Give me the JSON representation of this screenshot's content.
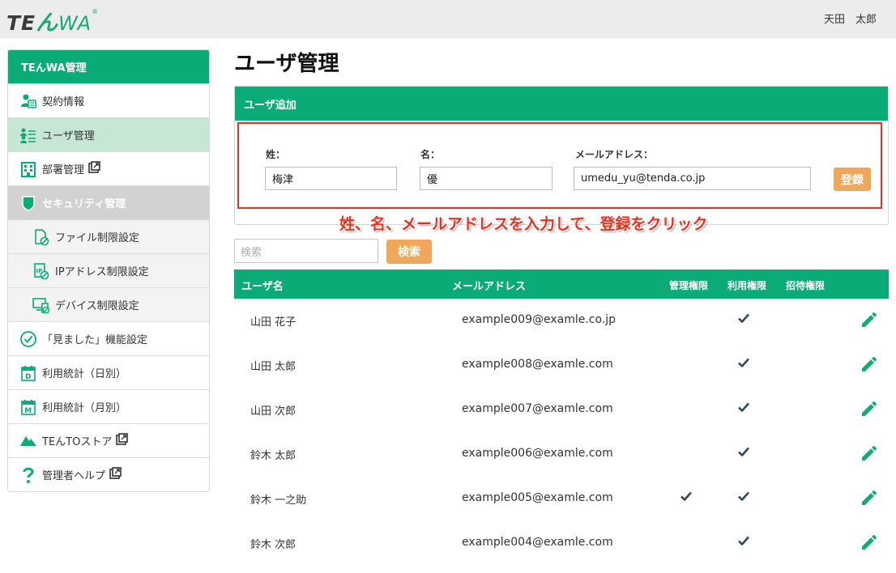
{
  "header": {
    "logo": {
      "part1": "TE",
      "part2": "ん",
      "part3": "WA",
      "reg": "®"
    },
    "user_name": "天田　太郎"
  },
  "sidebar": {
    "title": "TEんWA管理",
    "items": [
      {
        "label": "契約情報",
        "icon": "contract-user-icon"
      },
      {
        "label": "ユーザ管理",
        "icon": "user-list-icon"
      },
      {
        "label": "部署管理",
        "icon": "building-icon",
        "external": true
      },
      {
        "label": "セキュリティ管理",
        "icon": "shield-icon"
      },
      {
        "label": "ファイル制限設定",
        "icon": "file-restrict-icon"
      },
      {
        "label": "IPアドレス制限設定",
        "icon": "ip-restrict-icon"
      },
      {
        "label": "デバイス制限設定",
        "icon": "device-restrict-icon"
      },
      {
        "label": "「見ました」機能設定",
        "icon": "check-circle-icon"
      },
      {
        "label": "利用統計（日別）",
        "icon": "calendar-day-icon"
      },
      {
        "label": "利用統計（月別）",
        "icon": "calendar-month-icon"
      },
      {
        "label": "TEんTOストア",
        "icon": "store-icon",
        "external": true
      },
      {
        "label": "管理者ヘルプ",
        "icon": "help-icon",
        "external": true
      }
    ]
  },
  "main": {
    "title": "ユーザ管理",
    "add_user": {
      "heading": "ユーザ追加",
      "last_name_label": "姓：",
      "last_name_value": "梅津",
      "first_name_label": "名：",
      "first_name_value": "優",
      "email_label": "メールアドレス：",
      "email_value": "umedu_yu@tenda.co.jp",
      "register_button": "登録"
    },
    "annotation": "姓、名、メールアドレスを入力して、登録をクリック",
    "search": {
      "placeholder": "検索",
      "button": "検索"
    },
    "table": {
      "headers": {
        "name": "ユーザ名",
        "email": "メールアドレス",
        "admin": "管理権限",
        "use": "利用権限",
        "invite": "招待権限"
      },
      "rows": [
        {
          "name": "山田 花子",
          "email": "example009@examle.co.jp",
          "admin": false,
          "use": true,
          "invite": false
        },
        {
          "name": "山田 太郎",
          "email": "example008@examle.com",
          "admin": false,
          "use": true,
          "invite": false
        },
        {
          "name": "山田 次郎",
          "email": "example007@examle.com",
          "admin": false,
          "use": true,
          "invite": false
        },
        {
          "name": "鈴木 太郎",
          "email": "example006@examle.com",
          "admin": false,
          "use": true,
          "invite": false
        },
        {
          "name": "鈴木 一之助",
          "email": "example005@examle.com",
          "admin": true,
          "use": true,
          "invite": false
        },
        {
          "name": "鈴木 次郎",
          "email": "example004@examle.com",
          "admin": false,
          "use": true,
          "invite": false
        }
      ]
    }
  },
  "colors": {
    "brand": "#0aab77",
    "accent": "#f1a75a",
    "annotation": "#e8321f",
    "active": "#c6e7d3"
  }
}
